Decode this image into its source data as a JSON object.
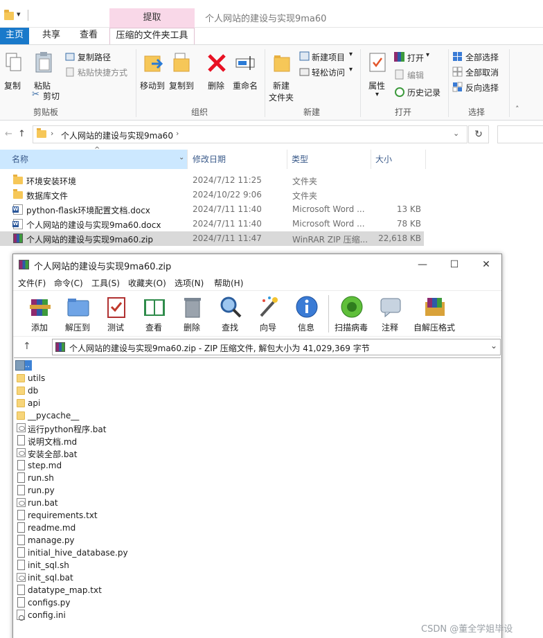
{
  "explorer": {
    "window_title": "个人网站的建设与实现9ma60",
    "context_tab": "提取",
    "tabs": [
      "主页",
      "共享",
      "查看",
      "压缩的文件夹工具"
    ],
    "ribbon": {
      "clipboard": {
        "label": "剪贴板",
        "copy": "复制",
        "paste": "粘贴",
        "copy_path": "复制路径",
        "paste_shortcut": "粘贴快捷方式",
        "cut": "剪切"
      },
      "organize": {
        "label": "组织",
        "move_to": "移动到",
        "copy_to": "复制到",
        "delete": "删除",
        "rename": "重命名"
      },
      "new": {
        "label": "新建",
        "new_folder_line1": "新建",
        "new_folder_line2": "文件夹",
        "new_item": "新建项目",
        "easy_access": "轻松访问"
      },
      "open": {
        "label": "打开",
        "properties": "属性",
        "open": "打开",
        "edit": "编辑",
        "history": "历史记录"
      },
      "select": {
        "label": "选择",
        "select_all": "全部选择",
        "select_none": "全部取消",
        "invert": "反向选择"
      }
    },
    "address": {
      "path": "个人网站的建设与实现9ma60",
      "refresh": "↻"
    },
    "columns": {
      "name": "名称",
      "date": "修改日期",
      "type": "类型",
      "size": "大小"
    },
    "files": [
      {
        "name": "环境安装环境",
        "date": "2024/7/12 11:25",
        "type": "文件夹",
        "size": "",
        "icon": "folder"
      },
      {
        "name": "数据库文件",
        "date": "2024/10/22 9:06",
        "type": "文件夹",
        "size": "",
        "icon": "folder"
      },
      {
        "name": "python-flask环境配置文档.docx",
        "date": "2024/7/11 11:40",
        "type": "Microsoft Word ...",
        "size": "13 KB",
        "icon": "word"
      },
      {
        "name": "个人网站的建设与实现9ma60.docx",
        "date": "2024/7/11 11:40",
        "type": "Microsoft Word ...",
        "size": "78 KB",
        "icon": "word"
      },
      {
        "name": "个人网站的建设与实现9ma60.zip",
        "date": "2024/7/11 11:47",
        "type": "WinRAR ZIP 压缩...",
        "size": "22,618 KB",
        "icon": "rar"
      }
    ]
  },
  "winrar": {
    "title": "个人网站的建设与实现9ma60.zip",
    "controls": {
      "minimize": "—",
      "maximize": "☐",
      "close": "✕"
    },
    "menu": [
      "文件(F)",
      "命令(C)",
      "工具(S)",
      "收藏夹(O)",
      "选项(N)",
      "帮助(H)"
    ],
    "toolbar": [
      "添加",
      "解压到",
      "测试",
      "查看",
      "删除",
      "查找",
      "向导",
      "信息",
      "扫描病毒",
      "注释",
      "自解压格式"
    ],
    "path_text": "个人网站的建设与实现9ma60.zip - ZIP 压缩文件, 解包大小为 41,029,369 字节",
    "up_item": "..",
    "entries": [
      {
        "name": "utils",
        "icon": "folder"
      },
      {
        "name": "db",
        "icon": "folder"
      },
      {
        "name": "api",
        "icon": "folder"
      },
      {
        "name": "__pycache__",
        "icon": "folder"
      },
      {
        "name": "运行python程序.bat",
        "icon": "bat"
      },
      {
        "name": "说明文档.md",
        "icon": "file"
      },
      {
        "name": "安装全部.bat",
        "icon": "bat"
      },
      {
        "name": "step.md",
        "icon": "file"
      },
      {
        "name": "run.sh",
        "icon": "file"
      },
      {
        "name": "run.py",
        "icon": "file"
      },
      {
        "name": "run.bat",
        "icon": "bat"
      },
      {
        "name": "requirements.txt",
        "icon": "file"
      },
      {
        "name": "readme.md",
        "icon": "file"
      },
      {
        "name": "manage.py",
        "icon": "file"
      },
      {
        "name": "initial_hive_database.py",
        "icon": "file"
      },
      {
        "name": "init_sql.sh",
        "icon": "file"
      },
      {
        "name": "init_sql.bat",
        "icon": "bat"
      },
      {
        "name": "datatype_map.txt",
        "icon": "file"
      },
      {
        "name": "configs.py",
        "icon": "file"
      },
      {
        "name": "config.ini",
        "icon": "ini"
      }
    ]
  },
  "watermark": "CSDN @董全学姐毕设",
  "colors": {
    "accent": "#1979ca",
    "context_tab": "#f9d8e8",
    "selected_row": "#d9d9d9",
    "header_selected": "#cce8ff"
  }
}
